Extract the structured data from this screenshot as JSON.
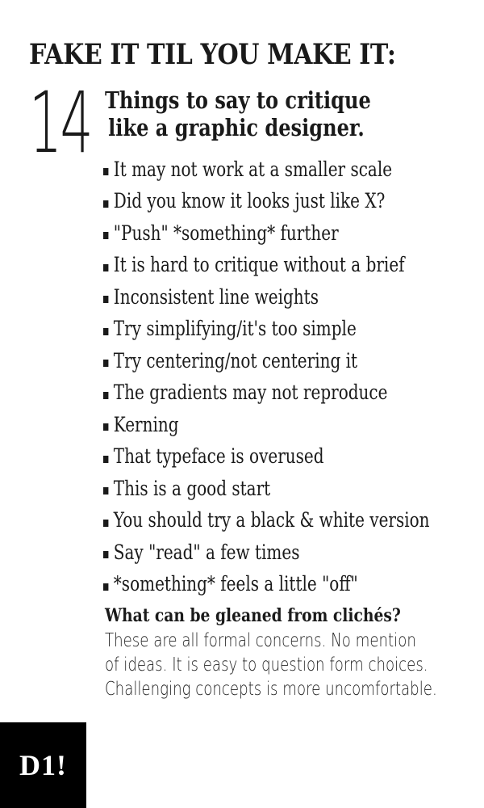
{
  "header": {
    "title": "FAKE IT TIL YOU MAKE IT:",
    "number": "14",
    "subtitle_line1": "Things to say to critique",
    "subtitle_line2": "like a graphic designer."
  },
  "list": {
    "bullet_icon": "square-bullet",
    "items": [
      "It may not work at a smaller scale",
      "Did you know it looks just like X?",
      "\"Push\" *something* further",
      "It is hard to critique without a brief",
      "Inconsistent line weights",
      "Try simplifying/it's too simple",
      "Try centering/not centering it",
      "The gradients may not reproduce",
      "Kerning",
      "That typeface is overused",
      "This is a good start",
      "You should try a black & white version",
      "Say \"read\" a few times",
      "*something* feels a little \"off\""
    ]
  },
  "conclusion": {
    "heading": "What can be gleaned from clichés?",
    "lines": [
      "These are all formal concerns. No mention",
      "of ideas. It is easy to question form choices.",
      "Challenging concepts is more uncomfortable."
    ]
  },
  "logo": {
    "text": "D1!",
    "background": "#000000",
    "color": "#ffffff"
  },
  "colors": {
    "text": "#1a1a1a",
    "background": "#ffffff"
  }
}
